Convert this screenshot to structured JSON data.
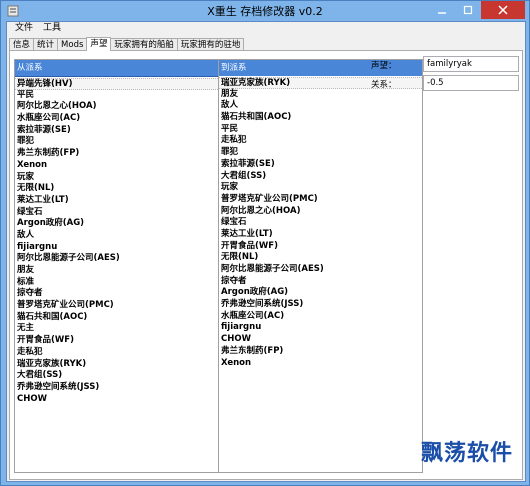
{
  "window": {
    "title": "X重生 存档修改器 v0.2"
  },
  "menu": [
    "文件",
    "工具"
  ],
  "tabs": [
    "信息",
    "统计",
    "Mods",
    "声望",
    "玩家拥有的船舶",
    "玩家拥有的驻地"
  ],
  "active_tab": "声望",
  "left_list": {
    "header": "从派系",
    "items": [
      "异端先锋(HV)",
      "平民",
      "阿尔比恩之心(HOA)",
      "水瓶座公司(AC)",
      "索拉菲源(SE)",
      "罪犯",
      "弗兰东制药(FP)",
      "Xenon",
      "玩家",
      "无限(NL)",
      "莱达工业(LT)",
      "绿宝石",
      "Argon政府(AG)",
      "敌人",
      "fijiargnu",
      "阿尔比恩能源子公司(AES)",
      "朋友",
      "标准",
      "掠夺者",
      "普罗塔克矿业公司(PMC)",
      "猫石共和国(AOC)",
      "无主",
      "开胃食品(WF)",
      "走私犯",
      "瑞亚克家族(RYK)",
      "大君组(SS)",
      "乔弗逊空间系统(JSS)",
      "CHOW"
    ]
  },
  "right_list": {
    "header": "到派系",
    "items": [
      "瑞亚克家族(RYK)",
      "朋友",
      "敌人",
      "猫石共和国(AOC)",
      "平民",
      "走私犯",
      "罪犯",
      "索拉菲源(SE)",
      "大君组(SS)",
      "玩家",
      "普罗塔克矿业公司(PMC)",
      "阿尔比恩之心(HOA)",
      "绿宝石",
      "莱达工业(LT)",
      "开胃食品(WF)",
      "无限(NL)",
      "阿尔比恩能源子公司(AES)",
      "掠夺者",
      "Argon政府(AG)",
      "乔弗逊空间系统(JSS)",
      "水瓶座公司(AC)",
      "fijiargnu",
      "CHOW",
      "弗兰东制药(FP)",
      "Xenon"
    ]
  },
  "fields": {
    "reputation_label": "声望：",
    "reputation_value": "familyryak",
    "relation_label": "关系：",
    "relation_value": "-0.5"
  },
  "watermark": "飘荡软件"
}
